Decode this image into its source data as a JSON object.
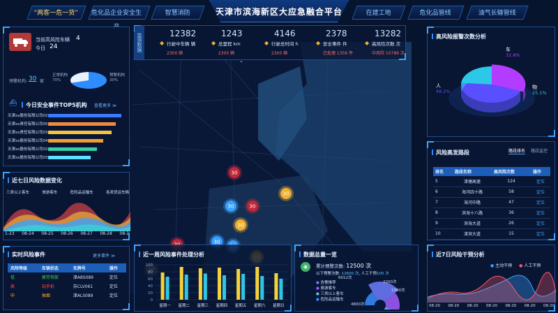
{
  "header": {
    "title": "天津市滨海新区大应急融合平台",
    "tabs_left": [
      "“两客一危一货”",
      "危化品企业安全生产",
      "智慧消防"
    ],
    "tabs_right": [
      "在建工地",
      "危化品管线",
      "油气长输管线"
    ]
  },
  "high_risk": {
    "label": "当前高风险车辆",
    "count": "4",
    "today_label": "今日",
    "today_count": "24"
  },
  "warning_org": {
    "label": "预警机构:",
    "value": "30",
    "unit": "家",
    "normal_label": "正常机构",
    "normal_pct": "70%",
    "warn_label": "预警机构",
    "warn_pct": "30%",
    "normal_value": 70,
    "warn_value": 30
  },
  "top5": {
    "title": "今日安全事件TOP5机构",
    "more": "查看更多 ≫",
    "rows": [
      {
        "name": "天津xx股份有限公司02",
        "value": 95,
        "color": "#3d7bff"
      },
      {
        "name": "天津xx责任有限公司05",
        "value": 88,
        "color": "#f28c38"
      },
      {
        "name": "天津xx责任有限公司03",
        "value": 83,
        "color": "#f4c242"
      },
      {
        "name": "天津xx股份有限公司04",
        "value": 72,
        "color": "#f0a030"
      },
      {
        "name": "天津xx股份有限公司02",
        "value": 64,
        "color": "#34d3a4"
      },
      {
        "name": "天津xx股份有限公司03",
        "value": 55,
        "color": "#5ce0ff"
      }
    ]
  },
  "seven_day": {
    "title": "近七日风险数据变化",
    "categories": [
      "三类以上客车",
      "旅游客车",
      "危险品运输车",
      "各类货运车辆"
    ],
    "dates": [
      "1-23",
      "08-24",
      "08-25",
      "08-26",
      "08-27",
      "08-28",
      "08-2"
    ]
  },
  "realtime": {
    "title": "实时风险事件",
    "more": "更多事件 ≫",
    "headers": [
      "风险等级",
      "车辆状态",
      "车牌号",
      "操作"
    ],
    "rows": [
      {
        "level": "低",
        "state": "疲劳驾驶",
        "plate": "津A8S089",
        "op": "定位",
        "color": "#3fd35f"
      },
      {
        "level": "高",
        "state": "玩手机",
        "plate": "苏CLV061",
        "op": "定位",
        "color": "#ff4a4a"
      },
      {
        "level": "中",
        "state": "抽烟",
        "plate": "津ALS089",
        "op": "定位",
        "color": "#ffb020"
      }
    ]
  },
  "monitor": {
    "side_label": "监测数据",
    "stats": [
      {
        "value": "12382",
        "label": "行驶中车辆",
        "unit": "辆"
      },
      {
        "value": "1243",
        "label": "总里程",
        "unit": "km"
      },
      {
        "value": "4146",
        "label": "行驶总时间",
        "unit": "h"
      },
      {
        "value": "2378",
        "label": "安全事件",
        "unit": "件"
      },
      {
        "value": "13282",
        "label": "高风险次数",
        "unit": "次"
      }
    ],
    "sub": [
      {
        "label": "",
        "value": "2300 辆"
      },
      {
        "label": "",
        "value": "2300 辆"
      },
      {
        "label": "",
        "value": "2300 辆"
      },
      {
        "label": "已处理",
        "value": "1356 件"
      },
      {
        "label": "中风险",
        "value": "10789 次"
      }
    ]
  },
  "map_markers": [
    {
      "label": "30",
      "color": "#c0283a",
      "x": 336,
      "y": 247
    },
    {
      "label": "30",
      "color": "#c0283a",
      "x": 362,
      "y": 295
    },
    {
      "label": "30",
      "color": "#3aa0ff",
      "x": 331,
      "y": 295
    },
    {
      "label": "30",
      "color": "#f0b030",
      "x": 410,
      "y": 277
    },
    {
      "label": "30",
      "color": "#f0b030",
      "x": 345,
      "y": 322
    },
    {
      "label": "30",
      "color": "#3aa0ff",
      "x": 311,
      "y": 346
    },
    {
      "label": "30",
      "color": "#c0283a",
      "x": 254,
      "y": 350
    },
    {
      "label": "30",
      "color": "#3aa0ff",
      "x": 334,
      "y": 352
    },
    {
      "label": "30",
      "color": "#f0b030",
      "x": 368,
      "y": 368
    },
    {
      "label": "30",
      "color": "#7a6a60",
      "x": 217,
      "y": 386
    }
  ],
  "week_chart": {
    "title": "近一周风险事件处理分析",
    "y_ticks": [
      "100",
      "80",
      "60",
      "40",
      "20",
      "0"
    ],
    "categories": [
      "星期一",
      "星期二",
      "星期三",
      "星期四",
      "星期五",
      "星期六",
      "星期日"
    ],
    "series_a": [
      78,
      94,
      90,
      92,
      88,
      94,
      76
    ],
    "series_b": [
      66,
      72,
      75,
      70,
      74,
      68,
      60
    ],
    "ylim": [
      0,
      100
    ]
  },
  "data_overview": {
    "title": "数据总量一览",
    "total_label": "累计预警次数:",
    "total_value": "12500 次",
    "sub_label": "以下预警次数:",
    "machine": "12600 次",
    "manual_label": "人工干预",
    "manual": "100 次",
    "legend": [
      "告警推荐",
      "旅游客车",
      "三类以上客车",
      "危险品运输车"
    ],
    "legend_colors": [
      "#6f7cff",
      "#a35cff",
      "#5ec8ff",
      "#3a8cff"
    ],
    "values": [
      "1300次",
      "6012次",
      "2200次",
      "4800次"
    ]
  },
  "risk_pie": {
    "title": "高风险报警次数分析",
    "slices": [
      {
        "name": "车",
        "pct": "32.8%",
        "value": 32.8,
        "color": "#b23cff"
      },
      {
        "name": "人",
        "pct": "48.2%",
        "value": 48.2,
        "color": "#5a4fff"
      },
      {
        "name": "物",
        "pct": "25.1%",
        "value": 25.1,
        "color": "#2cc8e8"
      }
    ]
  },
  "road": {
    "title": "风险高发路段",
    "tabs": [
      "路段排名",
      "路段监控"
    ],
    "headers": [
      "排名",
      "路段名称",
      "高风险次数",
      "操作"
    ],
    "rows": [
      {
        "rank": "5",
        "name": "津塘高速",
        "count": "124",
        "op": "定位"
      },
      {
        "rank": "6",
        "name": "海河四十路",
        "count": "58",
        "op": "定位"
      },
      {
        "rank": "7",
        "name": "海河中路",
        "count": "47",
        "op": "定位"
      },
      {
        "rank": "8",
        "name": "滨海十八路",
        "count": "36",
        "op": "定位"
      },
      {
        "rank": "9",
        "name": "滨海大道",
        "count": "26",
        "op": "定位"
      },
      {
        "rank": "10",
        "name": "津滨大道",
        "count": "15",
        "op": "定位"
      }
    ]
  },
  "intervene": {
    "title": "近7日风险干预分析",
    "legend": [
      "主动干预",
      "人工干预"
    ],
    "legend_colors": [
      "#3aa0ff",
      "#ff5a6a"
    ],
    "dates": [
      "08-20",
      "08-20",
      "08-20",
      "08-20",
      "08-20",
      "08-20",
      "08-20"
    ]
  }
}
